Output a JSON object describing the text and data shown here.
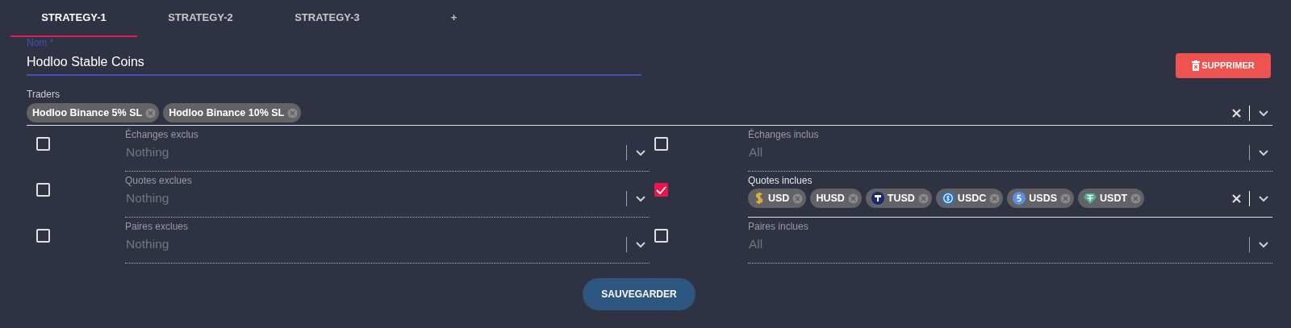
{
  "tabs": [
    {
      "label": "STRATEGY-1",
      "selected": true
    },
    {
      "label": "STRATEGY-2",
      "selected": false
    },
    {
      "label": "STRATEGY-3",
      "selected": false
    },
    {
      "label": "+",
      "selected": false
    }
  ],
  "name_field": {
    "label": "Nom *",
    "value": "Hodloo Stable Coins"
  },
  "delete_button": "SUPPRIMER",
  "traders": {
    "label": "Traders",
    "chips": [
      {
        "label": "Hodloo Binance 5% SL"
      },
      {
        "label": "Hodloo Binance 10% SL"
      }
    ]
  },
  "filters": [
    {
      "checked": false,
      "label": "Échanges exclus",
      "placeholder": "Nothing"
    },
    {
      "checked": false,
      "label": "Échanges inclus",
      "placeholder": "All"
    },
    {
      "checked": false,
      "label": "Quotes exclues",
      "placeholder": "Nothing"
    },
    {
      "checked": true,
      "label": "Quotes inclues",
      "chips": [
        {
          "label": "USD",
          "kind": "dollar"
        },
        {
          "label": "HUSD",
          "kind": "plain"
        },
        {
          "label": "TUSD",
          "kind": "tusd"
        },
        {
          "label": "USDC",
          "kind": "usdc"
        },
        {
          "label": "USDS",
          "kind": "usds"
        },
        {
          "label": "USDT",
          "kind": "usdt"
        }
      ]
    },
    {
      "checked": false,
      "label": "Paires exclues",
      "placeholder": "Nothing"
    },
    {
      "checked": false,
      "label": "Paires inclues",
      "placeholder": "All"
    }
  ],
  "save_button": "SAUVEGARDER"
}
